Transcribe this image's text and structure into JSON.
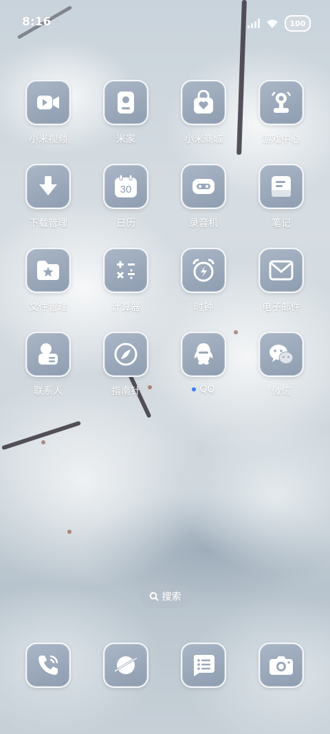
{
  "status_bar": {
    "time": "8:16",
    "battery": "100",
    "icons": [
      "signal-icon",
      "wifi-icon",
      "battery-icon"
    ]
  },
  "apps": [
    {
      "label": "小米视频",
      "icon": "video-camera-icon"
    },
    {
      "label": "米家",
      "icon": "home-device-icon"
    },
    {
      "label": "小米商城",
      "icon": "shopping-bag-icon"
    },
    {
      "label": "游戏中心",
      "icon": "game-center-icon"
    },
    {
      "label": "下载管理",
      "icon": "download-arrow-icon"
    },
    {
      "label": "日历",
      "icon": "calendar-icon",
      "date": "30"
    },
    {
      "label": "录音机",
      "icon": "recorder-icon"
    },
    {
      "label": "笔记",
      "icon": "notes-icon"
    },
    {
      "label": "文件管理",
      "icon": "folder-star-icon"
    },
    {
      "label": "计算器",
      "icon": "calculator-icon"
    },
    {
      "label": "时钟",
      "icon": "alarm-clock-icon"
    },
    {
      "label": "电子邮件",
      "icon": "envelope-icon"
    },
    {
      "label": "联系人",
      "icon": "contact-card-icon"
    },
    {
      "label": "指南针",
      "icon": "compass-icon"
    },
    {
      "label": "QQ",
      "icon": "qq-penguin-icon",
      "new_indicator": true
    },
    {
      "label": "微信",
      "icon": "wechat-icon"
    }
  ],
  "search": {
    "label": "搜索",
    "icon": "search-icon"
  },
  "dock": [
    {
      "name": "phone",
      "icon": "phone-icon"
    },
    {
      "name": "browser",
      "icon": "browser-planet-icon"
    },
    {
      "name": "messages",
      "icon": "message-list-icon"
    },
    {
      "name": "camera",
      "icon": "camera-icon"
    }
  ],
  "colors": {
    "icon_bg": "#9aa8ba",
    "indicator": "#3c7bff"
  }
}
